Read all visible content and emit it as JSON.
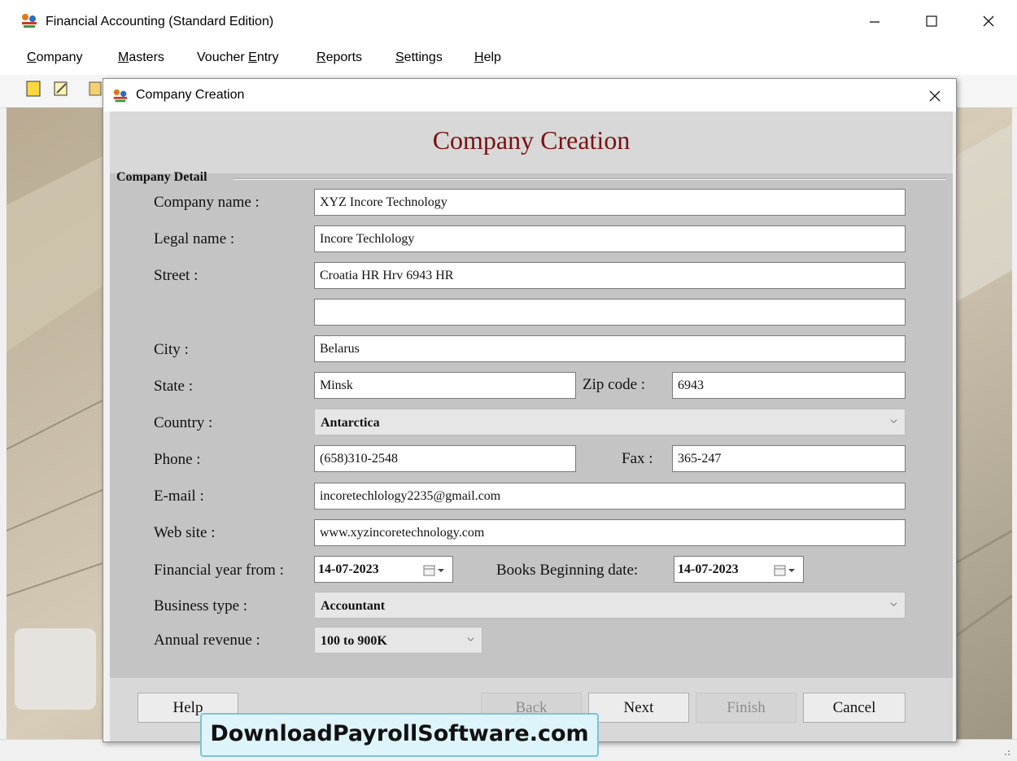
{
  "window": {
    "title": "Financial Accounting (Standard Edition)",
    "minimize_glyph": "—",
    "maximize_glyph": "☐",
    "close_glyph": "✕",
    "icon": "app-logo-icon"
  },
  "menu": {
    "items": [
      {
        "first": "C",
        "rest": "ompany"
      },
      {
        "first": "M",
        "rest": "asters"
      },
      {
        "pre": "Voucher ",
        "first": "E",
        "rest": "ntry"
      },
      {
        "first": "R",
        "rest": "eports"
      },
      {
        "first": "S",
        "rest": "ettings"
      },
      {
        "first": "H",
        "rest": "elp"
      }
    ]
  },
  "toolbar": {
    "icons": [
      "new-icon",
      "edit-icon",
      "grid-icon"
    ]
  },
  "dialog": {
    "title": "Company Creation",
    "heading": "Company Creation",
    "close_glyph": "✕",
    "group_title": "Company Detail",
    "labels": {
      "company_name": "Company name :",
      "legal_name": "Legal name :",
      "street": "Street :",
      "city": "City :",
      "state": "State :",
      "zip": "Zip code :",
      "country": "Country :",
      "phone": "Phone :",
      "fax": "Fax :",
      "email": "E-mail :",
      "website": "Web site :",
      "fin_year": "Financial year from :",
      "books_begin": "Books Beginning date:",
      "business_type": "Business type :",
      "annual_revenue": "Annual revenue :"
    },
    "values": {
      "company_name": "XYZ Incore Technology",
      "legal_name": "Incore Techlology",
      "street1": "Croatia HR Hrv 6943 HR",
      "street2": "",
      "city": "Belarus",
      "state": "Minsk",
      "zip": "6943",
      "country": "Antarctica",
      "phone": "(658)310-2548",
      "fax": "365-247",
      "email": "incoretechlology2235@gmail.com",
      "website": "www.xyzincoretechnology.com",
      "fin_year": "14-07-2023",
      "books_begin": "14-07-2023",
      "business_type": "Accountant",
      "annual_revenue": "100 to 900K"
    },
    "buttons": {
      "help": "Help",
      "back": "Back",
      "next": "Next",
      "finish": "Finish",
      "cancel": "Cancel"
    }
  },
  "watermark": "DownloadPayrollSoftware.com",
  "colors": {
    "heading": "#7a1212",
    "body_bg": "#c4c4c4",
    "header_bg": "#d8d8d8",
    "watermark_bg": "#ddf4fb"
  }
}
